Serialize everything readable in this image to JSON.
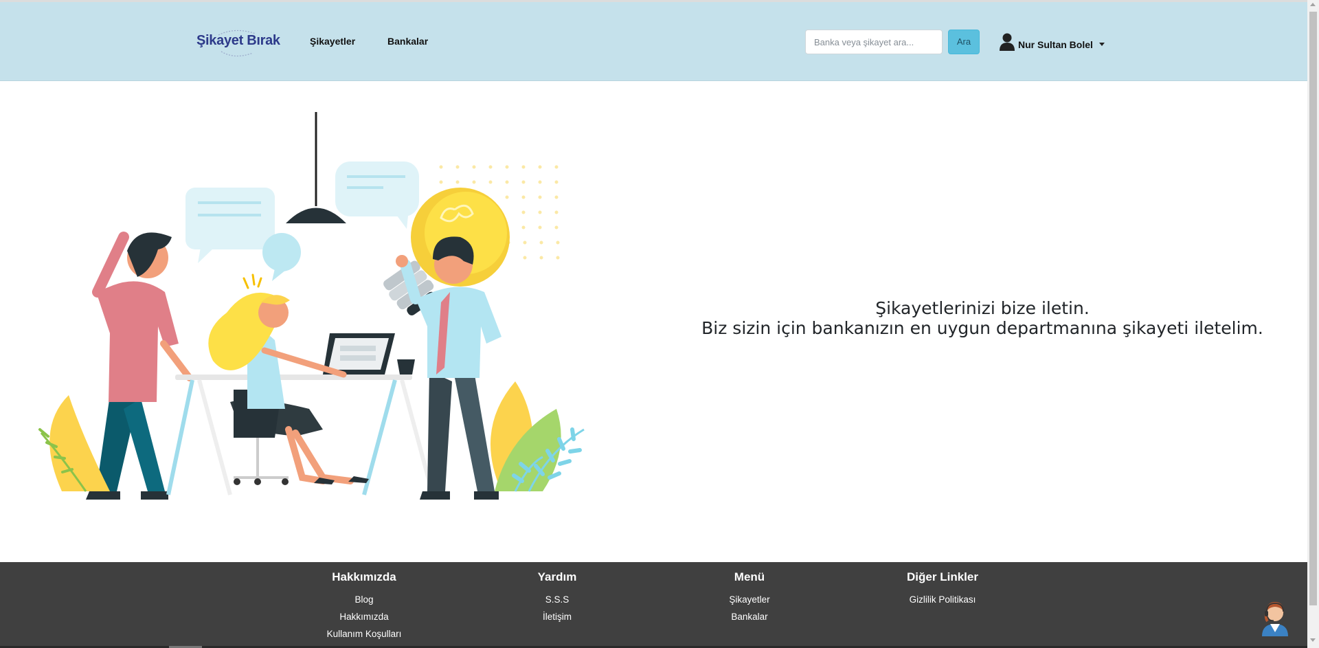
{
  "header": {
    "logo_text": "Şikayet Bırak",
    "nav": [
      {
        "label": "Şikayetler"
      },
      {
        "label": "Bankalar"
      }
    ],
    "search": {
      "placeholder": "Banka veya şikayet ara...",
      "value": "",
      "button_label": "Ara"
    },
    "user": {
      "name": "Nur Sultan Bolel",
      "icon": "user-icon"
    }
  },
  "hero": {
    "line1": "Şikayetlerinizi bize iletin.",
    "line2": "Biz sizin için bankanızın en uygun departmanına şikayeti iletelim.",
    "illustration": "team-working-illustration"
  },
  "footer": {
    "columns": [
      {
        "title": "Hakkımızda",
        "links": [
          "Blog",
          "Hakkımızda",
          "Kullanım Koşulları"
        ]
      },
      {
        "title": "Yardım",
        "links": [
          "S.S.S",
          "İletişim"
        ]
      },
      {
        "title": "Menü",
        "links": [
          "Şikayetler",
          "Bankalar"
        ]
      },
      {
        "title": "Diğer Linkler",
        "links": [
          "Gizlilik Politikası"
        ]
      }
    ],
    "support_icon": "support-agent-icon"
  },
  "colors": {
    "header_bg": "#c5e1eb",
    "button_bg": "#5bc0de",
    "footer_bg": "#404040",
    "logo": "#2d3a8a"
  }
}
